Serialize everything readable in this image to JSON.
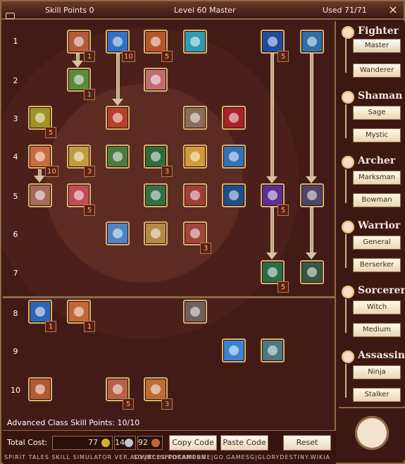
{
  "header": {
    "skill_points": "Skill Points 0",
    "level": "Level 60 Master",
    "used": "Used 71/71",
    "close_icon": "close-icon",
    "camera_icon": "camera-icon"
  },
  "rows": [
    "1",
    "2",
    "3",
    "4",
    "5",
    "6",
    "7",
    "8",
    "9",
    "10"
  ],
  "badges": {
    "r1_fist": "1",
    "r1_blue": "10",
    "r1_hammer": "5",
    "r1_right1": "5",
    "r2_green": "1",
    "r3_left": "5",
    "r4_left": "10",
    "r4_fist": "3",
    "r4_tree": "3",
    "r5_face": "5",
    "r5_purple": "5",
    "r6_right": "3",
    "r7_green": "5",
    "r8_blue": "1",
    "r8_fist": "1",
    "r10_fist": "5",
    "r10_swirl": "3"
  },
  "classes": [
    {
      "name": "Fighter",
      "sub": [
        "Master",
        "Wanderer"
      ],
      "icon": "fighter-icon"
    },
    {
      "name": "Shaman",
      "sub": [
        "Sage",
        "Mystic"
      ],
      "icon": "shaman-icon"
    },
    {
      "name": "Archer",
      "sub": [
        "Marksman",
        "Bowman"
      ],
      "icon": "archer-icon"
    },
    {
      "name": "Warrior",
      "sub": [
        "General",
        "Berserker"
      ],
      "icon": "warrior-icon"
    },
    {
      "name": "Sorcerer",
      "sub": [
        "Witch",
        "Medium"
      ],
      "icon": "sorcerer-icon"
    },
    {
      "name": "Assassin",
      "sub": [
        "Ninja",
        "Stalker"
      ],
      "icon": "assassin-icon"
    }
  ],
  "advanced": "Advanced Class Skill Points: 10/10",
  "footer": {
    "total_cost_label": "Total Cost:",
    "gold": "77",
    "silver": "14",
    "copper": "92",
    "copy": "Copy Code",
    "paste": "Paste Code",
    "reset": "Reset"
  },
  "credits": "SPIRIT TALES SKILL SIMULATOR VER.ADV|BY:HIPPOCAMPUS",
  "sources": "SOURCES:KORAMGAME|GO.GAMESG|GLORYDESTINY.WIKIA"
}
